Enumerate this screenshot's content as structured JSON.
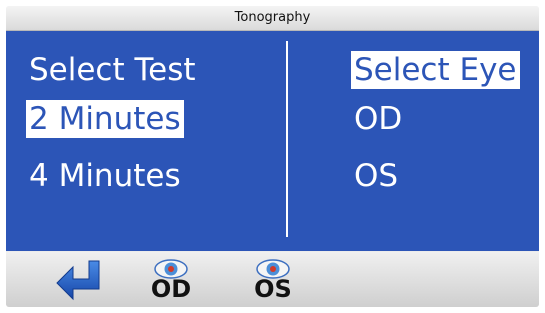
{
  "window": {
    "title": "Tonography"
  },
  "tests": {
    "header": "Select Test",
    "options": [
      "2 Minutes",
      "4 Minutes"
    ],
    "selected_index": 0
  },
  "eyes": {
    "header": "Select Eye",
    "options": [
      "OD",
      "OS"
    ],
    "header_highlighted": true
  },
  "toolbar": {
    "back_icon": "return-arrow-icon",
    "od_icon": "eye-icon",
    "od_label": "OD",
    "os_icon": "eye-icon",
    "os_label": "OS"
  },
  "colors": {
    "panel": "#2c55b7",
    "text": "#ffffff",
    "arrow": "#1f5fc4",
    "toolbar": "#e4e4e4"
  }
}
